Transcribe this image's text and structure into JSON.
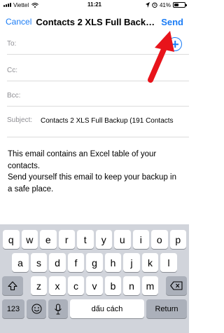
{
  "status_bar": {
    "carrier": "Viettel",
    "time": "11:21",
    "battery": "41%",
    "battery_level": 0.41
  },
  "nav": {
    "cancel_label": "Cancel",
    "title": "Contacts 2 XLS Full Backu...",
    "send_label": "Send"
  },
  "fields": {
    "to_label": "To:",
    "cc_label": "Cc:",
    "bcc_label": "Bcc:",
    "subject_label": "Subject:",
    "subject_value": "Contacts 2 XLS Full Backup (191 Contacts"
  },
  "body": {
    "line1": "This email contains an Excel table of your contacts.",
    "line2": "Send yourself this email to keep your backup in a safe place."
  },
  "keyboard": {
    "row1": [
      "q",
      "w",
      "e",
      "r",
      "t",
      "y",
      "u",
      "i",
      "o",
      "p"
    ],
    "row2": [
      "a",
      "s",
      "d",
      "f",
      "g",
      "h",
      "j",
      "k",
      "l"
    ],
    "row3": [
      "z",
      "x",
      "c",
      "v",
      "b",
      "n",
      "m"
    ],
    "numbers_label": "123",
    "space_label": "dấu cách",
    "return_label": "Return"
  },
  "colors": {
    "accent": "#1a7cf5",
    "annotation_arrow": "#e8141b",
    "keyboard_bg": "#d1d4db"
  },
  "icons": [
    "wifi-icon",
    "location-icon",
    "alarm-icon",
    "battery-icon",
    "add-contact-icon",
    "shift-icon",
    "backspace-icon",
    "emoji-icon",
    "microphone-icon",
    "red-arrow-annotation"
  ]
}
